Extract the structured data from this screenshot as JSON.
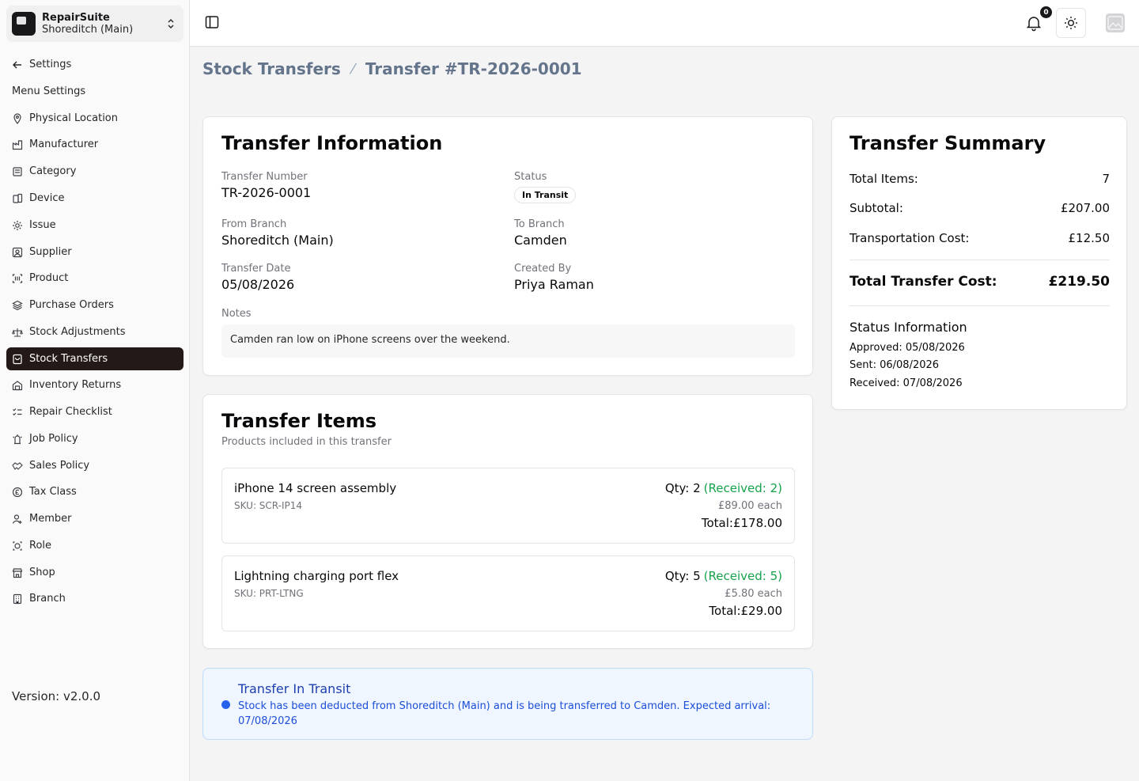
{
  "brand": {
    "name": "RepairSuite",
    "branch": "Shoreditch (Main)"
  },
  "sidebar": {
    "back_label": "Settings",
    "section_label": "Menu Settings",
    "items": [
      {
        "label": "Physical Location",
        "icon": "location-pin-icon"
      },
      {
        "label": "Manufacturer",
        "icon": "factory-icon"
      },
      {
        "label": "Category",
        "icon": "category-icon"
      },
      {
        "label": "Device",
        "icon": "device-icon"
      },
      {
        "label": "Issue",
        "icon": "issue-icon"
      },
      {
        "label": "Supplier",
        "icon": "supplier-icon"
      },
      {
        "label": "Product",
        "icon": "barcode-icon"
      },
      {
        "label": "Purchase Orders",
        "icon": "layers-icon"
      },
      {
        "label": "Stock Adjustments",
        "icon": "scale-icon"
      },
      {
        "label": "Stock Transfers",
        "icon": "transfer-icon"
      },
      {
        "label": "Inventory Returns",
        "icon": "return-icon"
      },
      {
        "label": "Repair Checklist",
        "icon": "checklist-icon"
      },
      {
        "label": "Job Policy",
        "icon": "policy-icon"
      },
      {
        "label": "Sales Policy",
        "icon": "handshake-icon"
      },
      {
        "label": "Tax Class",
        "icon": "currency-icon"
      },
      {
        "label": "Member",
        "icon": "member-icon"
      },
      {
        "label": "Role",
        "icon": "role-icon"
      },
      {
        "label": "Shop",
        "icon": "shop-icon"
      },
      {
        "label": "Branch",
        "icon": "building-icon"
      }
    ],
    "active_item": "Stock Transfers",
    "version": "Version: v2.0.0"
  },
  "header": {
    "notification_count": "0"
  },
  "breadcrumb": {
    "parent": "Stock Transfers",
    "current": "Transfer #TR-2026-0001"
  },
  "transfer_info": {
    "title": "Transfer Information",
    "transfer_number_label": "Transfer Number",
    "transfer_number": "TR-2026-0001",
    "status_label": "Status",
    "status": "In Transit",
    "from_branch_label": "From Branch",
    "from_branch": "Shoreditch (Main)",
    "to_branch_label": "To Branch",
    "to_branch": "Camden",
    "transfer_date_label": "Transfer Date",
    "transfer_date": "05/08/2026",
    "created_by_label": "Created By",
    "created_by": "Priya Raman",
    "notes_label": "Notes",
    "notes": "Camden ran low on iPhone screens over the weekend."
  },
  "transfer_items": {
    "title": "Transfer Items",
    "subtitle": "Products included in this transfer",
    "items": [
      {
        "name": "iPhone 14 screen assembly",
        "sku": "SKU: SCR-IP14",
        "qty": "Qty: 2",
        "received": "(Received: 2)",
        "each": "£89.00 each",
        "total": "Total:£178.00"
      },
      {
        "name": "Lightning charging port flex",
        "sku": "SKU: PRT-LTNG",
        "qty": "Qty: 5",
        "received": "(Received: 5)",
        "each": "£5.80 each",
        "total": "Total:£29.00"
      }
    ]
  },
  "alert": {
    "title": "Transfer In Transit",
    "body": "Stock has been deducted from Shoreditch (Main) and is being transferred to Camden. Expected arrival: 07/08/2026"
  },
  "summary": {
    "title": "Transfer Summary",
    "total_items_label": "Total Items:",
    "total_items": "7",
    "subtotal_label": "Subtotal:",
    "subtotal": "£207.00",
    "transport_label": "Transportation Cost:",
    "transport": "£12.50",
    "total_cost_label": "Total Transfer Cost:",
    "total_cost": "£219.50",
    "status_info_title": "Status Information",
    "approved": "Approved: 05/08/2026",
    "sent": "Sent: 06/08/2026",
    "received": "Received: 07/08/2026"
  },
  "colors": {
    "active_nav_bg": "#231a17",
    "received_green": "#16a34a",
    "alert_blue": "#2563eb",
    "alert_bg": "#eff6ff"
  }
}
